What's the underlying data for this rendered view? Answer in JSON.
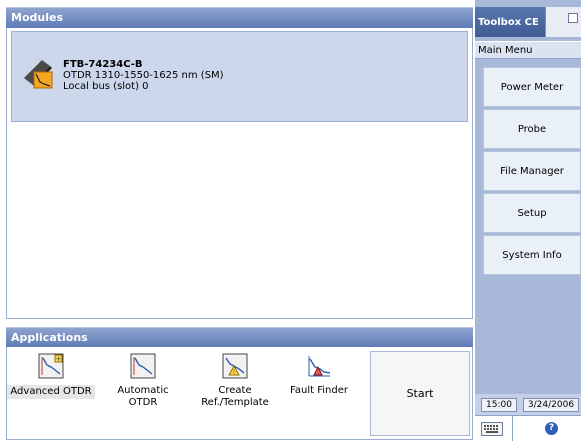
{
  "modules": {
    "header": "Modules",
    "items": [
      {
        "name": "FTB-74234C-B",
        "description": "OTDR 1310-1550-1625 nm (SM)",
        "location": "Local bus (slot) 0",
        "icon": "otdr-module-icon"
      }
    ]
  },
  "applications": {
    "header": "Applications",
    "items": [
      {
        "label_line1": "Advanced OTDR",
        "label_line2": "",
        "icon": "advanced-otdr-icon",
        "selected": true
      },
      {
        "label_line1": "Automatic",
        "label_line2": "OTDR",
        "icon": "automatic-otdr-icon",
        "selected": false
      },
      {
        "label_line1": "Create",
        "label_line2": "Ref./Template",
        "icon": "create-template-icon",
        "selected": false
      },
      {
        "label_line1": "Fault Finder",
        "label_line2": "",
        "icon": "fault-finder-icon",
        "selected": false
      }
    ],
    "start_label": "Start"
  },
  "sidebar": {
    "title": "Toolbox CE",
    "menu_label": "Main Menu",
    "buttons": [
      "Power Meter",
      "Probe",
      "File Manager",
      "Setup",
      "System Info"
    ],
    "time": "15:00",
    "date": "3/24/2006",
    "keyboard_icon": "keyboard-icon",
    "help_icon": "help-icon",
    "help_symbol": "?"
  },
  "colors": {
    "header_blue": "#5f7cb7",
    "selection": "#ccd7ec",
    "sidebar": "#a7b8d8"
  }
}
